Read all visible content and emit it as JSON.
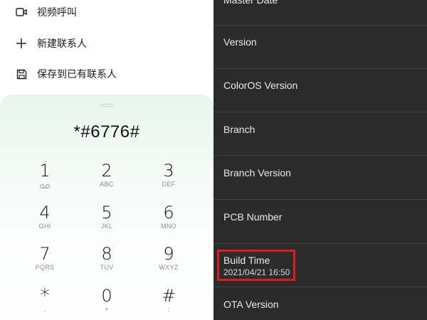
{
  "menu": {
    "items": [
      {
        "label": "视频呼叫",
        "icon": "video-call-icon"
      },
      {
        "label": "新建联系人",
        "icon": "plus-icon"
      },
      {
        "label": "保存到已有联系人",
        "icon": "save-icon"
      }
    ]
  },
  "dialer": {
    "number": "*#6776#",
    "keys": [
      {
        "digit": "1",
        "letters": "",
        "sub_icon": "voicemail-icon"
      },
      {
        "digit": "2",
        "letters": "ABC"
      },
      {
        "digit": "3",
        "letters": "DEF"
      },
      {
        "digit": "4",
        "letters": "GHI"
      },
      {
        "digit": "5",
        "letters": "JKL"
      },
      {
        "digit": "6",
        "letters": "MNO"
      },
      {
        "digit": "7",
        "letters": "PQRS"
      },
      {
        "digit": "8",
        "letters": "TUV"
      },
      {
        "digit": "9",
        "letters": "WXYZ"
      },
      {
        "digit": "*",
        "letters": ","
      },
      {
        "digit": "0",
        "letters": "+"
      },
      {
        "digit": "#",
        "letters": ";"
      }
    ]
  },
  "info": {
    "rows": [
      {
        "label": "Master Date"
      },
      {
        "label": "Version"
      },
      {
        "label": "ColorOS Version"
      },
      {
        "label": "Branch"
      },
      {
        "label": "Branch Version"
      },
      {
        "label": "PCB Number"
      },
      {
        "label": "Build Time",
        "value": "2021/04/21 16:50"
      },
      {
        "label": "OTA Version"
      }
    ]
  },
  "colors": {
    "highlight": "#e01b1b",
    "right_background": "#2b2b2b",
    "dialpad_tint": "#e8f5ee"
  }
}
